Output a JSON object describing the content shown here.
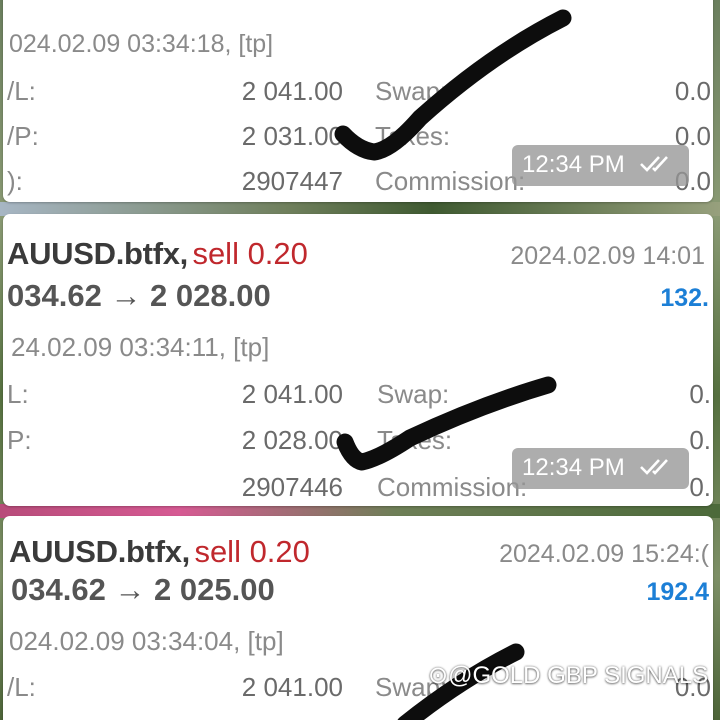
{
  "cards": [
    {
      "date": "024.02.09 03:34:18, [tp]",
      "sl_label": "/L:",
      "sl_value": "2 041.00",
      "tp_label": "/P:",
      "tp_value": "2 031.00",
      "id_label": "):",
      "id_value": "2907447",
      "swap_label": "Swap:",
      "swap_value": "0.0",
      "taxes_label": "Taxes:",
      "taxes_value": "0.0",
      "commission_label": "Commission:",
      "commission_value": "0.0",
      "stamp_time": "12:34 PM"
    },
    {
      "symbol": "AUUSD.btfx,",
      "side": "sell 0.20",
      "close_time": "2024.02.09 14:01",
      "prices": "034.62 → 2 028.00",
      "profit": "132.",
      "open_time": "24.02.09 03:34:11, [tp]",
      "sl_label": "L:",
      "sl_value": "2 041.00",
      "tp_label": "P:",
      "tp_value": "2 028.00",
      "id_value": "2907446",
      "swap_label": "Swap:",
      "swap_value": "0.",
      "taxes_label": "Taxes:",
      "taxes_value": "0.",
      "commission_label": "Commission:",
      "commission_value": "0.",
      "stamp_time": "12:34 PM"
    },
    {
      "symbol": "AUUSD.btfx,",
      "side": "sell 0.20",
      "close_time": "2024.02.09 15:24:(",
      "prices": "034.62 → 2 025.00",
      "profit": "192.4",
      "open_time": "024.02.09 03:34:04, [tp]",
      "sl_label": "/L:",
      "sl_value": "2 041.00",
      "swap_label": "Swap:",
      "swap_value": "0.0"
    }
  ],
  "watermark": "⊙@GOLD GBP SIGNALS",
  "colors": {
    "sell": "#c0282d",
    "profit": "#1c7fd6",
    "checkmark": "#111111"
  },
  "icons": [
    "double-check-icon",
    "checkmark-stroke-icon"
  ]
}
